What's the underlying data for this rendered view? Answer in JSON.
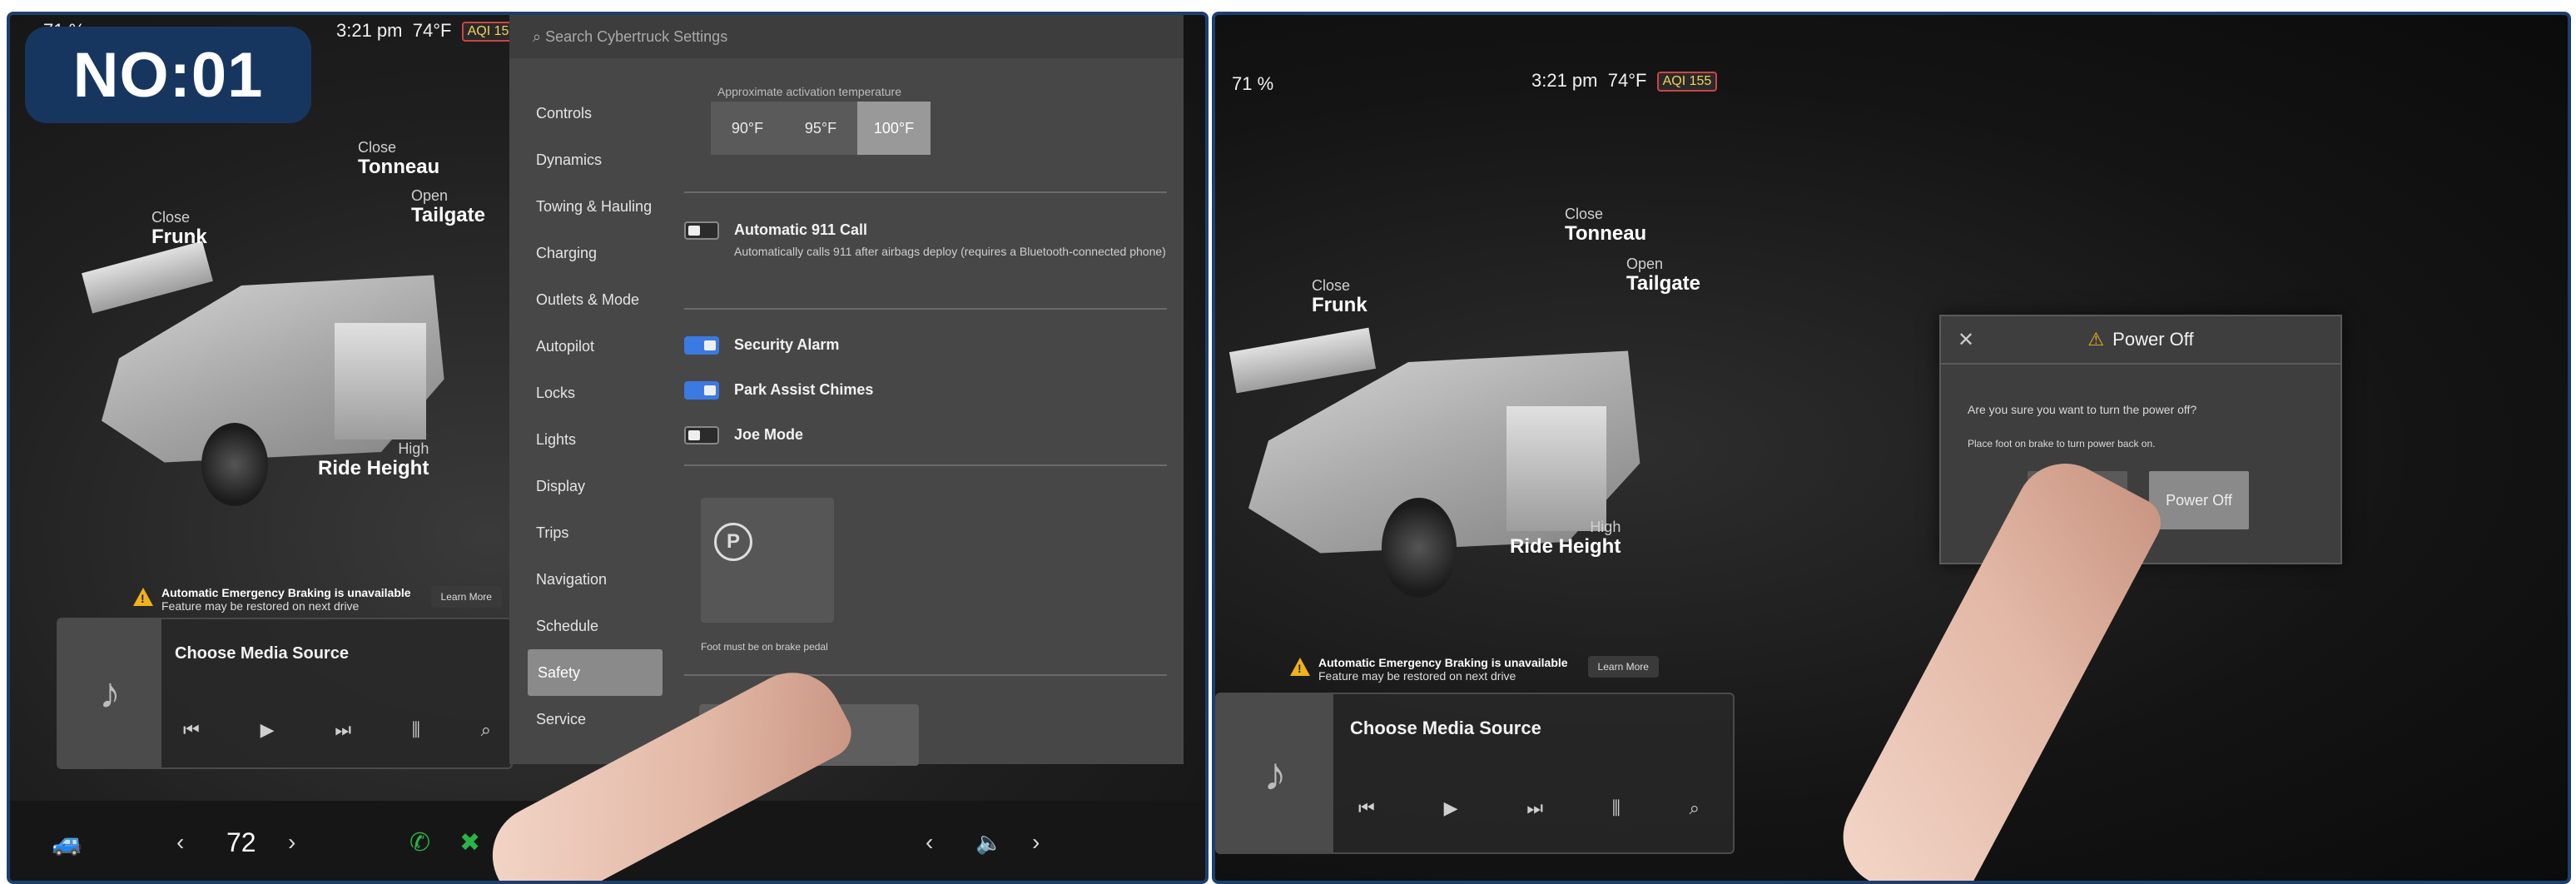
{
  "badge": {
    "label": "NO:01"
  },
  "status": {
    "battery": "71 %",
    "time": "3:21 pm",
    "temp": "74°F",
    "aqi": "AQI 155"
  },
  "vehicle_labels": {
    "frunk_action": "Close",
    "frunk": "Frunk",
    "tonneau_action": "Close",
    "tonneau": "Tonneau",
    "tailgate_action": "Open",
    "tailgate": "Tailgate",
    "ride_height_level": "High",
    "ride_height": "Ride Height"
  },
  "warning": {
    "title": "Automatic Emergency Braking is unavailable",
    "desc": "Feature may be restored on next drive",
    "learn_more": "Learn More"
  },
  "media": {
    "title": "Choose Media Source"
  },
  "settings": {
    "search_placeholder": "Search Cybertruck Settings",
    "nav": [
      "Controls",
      "Dynamics",
      "Towing & Hauling",
      "Charging",
      "Outlets & Mode",
      "Autopilot",
      "Locks",
      "Lights",
      "Display",
      "Trips",
      "Navigation",
      "Schedule",
      "Safety",
      "Service"
    ],
    "active_nav": "Safety",
    "temp_label": "Approximate activation temperature",
    "temp_options": [
      "90°F",
      "95°F",
      "100°F"
    ],
    "selected_temp": "100°F",
    "auto911_title": "Automatic 911 Call",
    "auto911_desc": "Automatically calls 911 after airbags deploy (requires a Bluetooth-connected phone)",
    "security_alarm": "Security Alarm",
    "park_assist": "Park Assist Chimes",
    "joe_mode": "Joe Mode",
    "power_note": "Foot must be on brake pedal",
    "power_off_button": "Power Off"
  },
  "bottom_bar": {
    "temperature": "72"
  },
  "dialog": {
    "title": "Power Off",
    "message": "Are you sure you want to turn the power off?",
    "hint": "Place foot on brake to turn power back on.",
    "cancel": "Cancel",
    "confirm": "Power Off"
  },
  "colors": {
    "badge": "#17365f",
    "toggle_on": "#3b7ae0",
    "warning": "#f0b21a"
  }
}
